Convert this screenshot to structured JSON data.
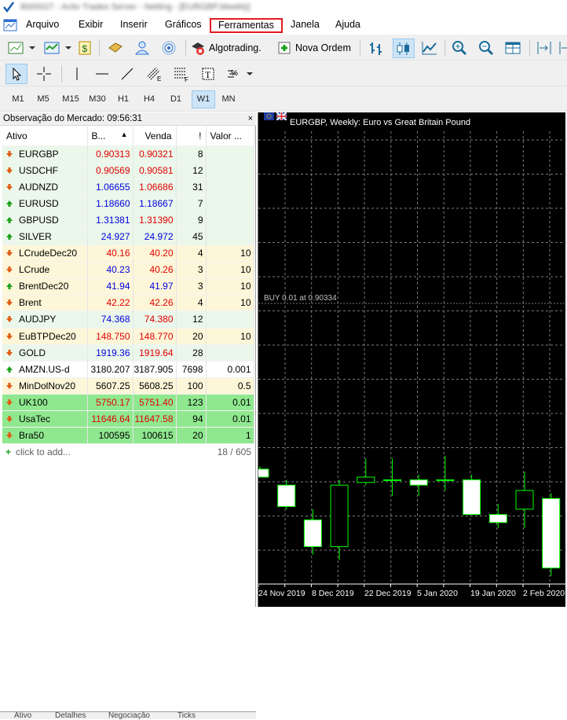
{
  "window": {
    "title": "8000027 - Activ Trades Server - Netting - [EURGBP,Weekly]"
  },
  "menu": {
    "items": [
      "Arquivo",
      "Exibir",
      "Inserir",
      "Gráficos",
      "Ferramentas",
      "Janela",
      "Ajuda"
    ],
    "highlighted": "Ferramentas"
  },
  "toolbar": {
    "algotrading_label": "Algotrading.",
    "new_order_label": "Nova Ordem"
  },
  "timeframes": {
    "items": [
      "M1",
      "M5",
      "M15",
      "M30",
      "H1",
      "H4",
      "D1",
      "W1",
      "MN"
    ],
    "active": "W1"
  },
  "market_watch": {
    "header": "Observação do Mercado: 09:56:31",
    "close": "×",
    "columns": [
      "Ativo",
      "B...",
      "Venda",
      "!",
      "Valor ..."
    ],
    "rows": [
      {
        "symbol": "EURGBP",
        "bid": "0.90313",
        "ask": "0.90321",
        "spread": "8",
        "value": "",
        "dir": "down",
        "bg": "#eaf7ea",
        "bidc": "#e00000",
        "askc": "#e00000"
      },
      {
        "symbol": "USDCHF",
        "bid": "0.90569",
        "ask": "0.90581",
        "spread": "12",
        "value": "",
        "dir": "down",
        "bg": "#eaf7ea",
        "bidc": "#e00000",
        "askc": "#e00000"
      },
      {
        "symbol": "AUDNZD",
        "bid": "1.06655",
        "ask": "1.06686",
        "spread": "31",
        "value": "",
        "dir": "down",
        "bg": "#eaf7ea",
        "bidc": "#0000e0",
        "askc": "#e00000"
      },
      {
        "symbol": "EURUSD",
        "bid": "1.18660",
        "ask": "1.18667",
        "spread": "7",
        "value": "",
        "dir": "up",
        "bg": "#eaf7ea",
        "bidc": "#0000e0",
        "askc": "#0000e0"
      },
      {
        "symbol": "GBPUSD",
        "bid": "1.31381",
        "ask": "1.31390",
        "spread": "9",
        "value": "",
        "dir": "up",
        "bg": "#eaf7ea",
        "bidc": "#0000e0",
        "askc": "#e00000"
      },
      {
        "symbol": "SILVER",
        "bid": "24.927",
        "ask": "24.972",
        "spread": "45",
        "value": "",
        "dir": "up",
        "bg": "#eaf7ea",
        "bidc": "#0000e0",
        "askc": "#0000e0"
      },
      {
        "symbol": "LCrudeDec20",
        "bid": "40.16",
        "ask": "40.20",
        "spread": "4",
        "value": "10",
        "dir": "down",
        "bg": "#fdf6d8",
        "bidc": "#e00000",
        "askc": "#e00000"
      },
      {
        "symbol": "LCrude",
        "bid": "40.23",
        "ask": "40.26",
        "spread": "3",
        "value": "10",
        "dir": "down",
        "bg": "#fdf6d8",
        "bidc": "#0000e0",
        "askc": "#e00000"
      },
      {
        "symbol": "BrentDec20",
        "bid": "41.94",
        "ask": "41.97",
        "spread": "3",
        "value": "10",
        "dir": "up",
        "bg": "#fdf6d8",
        "bidc": "#0000e0",
        "askc": "#0000e0"
      },
      {
        "symbol": "Brent",
        "bid": "42.22",
        "ask": "42.26",
        "spread": "4",
        "value": "10",
        "dir": "down",
        "bg": "#fdf6d8",
        "bidc": "#e00000",
        "askc": "#e00000"
      },
      {
        "symbol": "AUDJPY",
        "bid": "74.368",
        "ask": "74.380",
        "spread": "12",
        "value": "",
        "dir": "down",
        "bg": "#eaf7ea",
        "bidc": "#0000e0",
        "askc": "#e00000"
      },
      {
        "symbol": "EuBTPDec20",
        "bid": "148.750",
        "ask": "148.770",
        "spread": "20",
        "value": "10",
        "dir": "down",
        "bg": "#fdf6d8",
        "bidc": "#e00000",
        "askc": "#e00000"
      },
      {
        "symbol": "GOLD",
        "bid": "1919.36",
        "ask": "1919.64",
        "spread": "28",
        "value": "",
        "dir": "down",
        "bg": "#eaf7ea",
        "bidc": "#0000e0",
        "askc": "#e00000"
      },
      {
        "symbol": "AMZN.US-d",
        "bid": "3180.207",
        "ask": "3187.905",
        "spread": "7698",
        "value": "0.001",
        "dir": "up",
        "bg": "#ffffff",
        "bidc": "#000000",
        "askc": "#000000"
      },
      {
        "symbol": "MinDolNov20",
        "bid": "5607.25",
        "ask": "5608.25",
        "spread": "100",
        "value": "0.5",
        "dir": "down",
        "bg": "#fdf6d8",
        "bidc": "#000000",
        "askc": "#000000"
      },
      {
        "symbol": "UK100",
        "bid": "5750.17",
        "ask": "5751.40",
        "spread": "123",
        "value": "0.01",
        "dir": "down",
        "bg": "#8fe88f",
        "bidc": "#e00000",
        "askc": "#e00000"
      },
      {
        "symbol": "UsaTec",
        "bid": "11646.64",
        "ask": "11647.58",
        "spread": "94",
        "value": "0.01",
        "dir": "down",
        "bg": "#8fe88f",
        "bidc": "#e00000",
        "askc": "#e00000"
      },
      {
        "symbol": "Bra50",
        "bid": "100595",
        "ask": "100615",
        "spread": "20",
        "value": "1",
        "dir": "down",
        "bg": "#8fe88f",
        "bidc": "#000000",
        "askc": "#000000"
      }
    ],
    "add_label": "click to add...",
    "count": "18 / 605",
    "bottom_tabs": [
      "Ativo",
      "Detalhes",
      "Negociação",
      "Ticks"
    ]
  },
  "chart": {
    "title": "EURGBP, Weekly:  Euro vs Great Britain Pound",
    "trade_line_label": "BUY 0.01 at 0.90334",
    "x_labels": [
      "24 Nov 2019",
      "8 Dec 2019",
      "22 Dec 2019",
      "5 Jan 2020",
      "19 Jan 2020",
      "2 Feb 2020"
    ],
    "candles": [
      {
        "o": 0.855,
        "c": 0.852,
        "h": 0.856,
        "l": 0.852
      },
      {
        "o": 0.849,
        "c": 0.841,
        "h": 0.851,
        "l": 0.84
      },
      {
        "o": 0.836,
        "c": 0.826,
        "h": 0.84,
        "l": 0.823
      },
      {
        "o": 0.826,
        "c": 0.849,
        "h": 0.851,
        "l": 0.821
      },
      {
        "o": 0.85,
        "c": 0.852,
        "h": 0.859,
        "l": 0.849
      },
      {
        "o": 0.851,
        "c": 0.851,
        "h": 0.859,
        "l": 0.845
      },
      {
        "o": 0.851,
        "c": 0.849,
        "h": 0.853,
        "l": 0.845
      },
      {
        "o": 0.851,
        "c": 0.851,
        "h": 0.86,
        "l": 0.847
      },
      {
        "o": 0.851,
        "c": 0.838,
        "h": 0.853,
        "l": 0.838
      },
      {
        "o": 0.838,
        "c": 0.835,
        "h": 0.842,
        "l": 0.833
      },
      {
        "o": 0.84,
        "c": 0.847,
        "h": 0.854,
        "l": 0.833
      },
      {
        "o": 0.844,
        "c": 0.818,
        "h": 0.846,
        "l": 0.815
      }
    ]
  }
}
